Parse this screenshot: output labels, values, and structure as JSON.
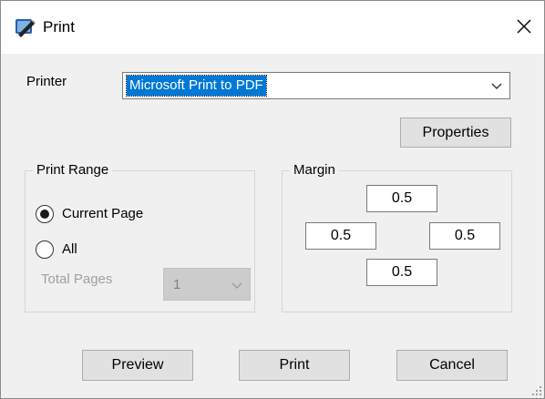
{
  "window": {
    "title": "Print",
    "close_glyph": "✕"
  },
  "printer": {
    "label": "Printer",
    "selected": "Microsoft Print to PDF",
    "properties_label": "Properties"
  },
  "print_range": {
    "legend": "Print Range",
    "options": [
      {
        "label": "Current Page",
        "selected": true
      },
      {
        "label": "All",
        "selected": false
      }
    ],
    "total_pages_label": "Total Pages",
    "total_pages_value": "1"
  },
  "margin": {
    "legend": "Margin",
    "top": "0.5",
    "left": "0.5",
    "right": "0.5",
    "bottom": "0.5"
  },
  "buttons": {
    "preview": "Preview",
    "print": "Print",
    "cancel": "Cancel"
  },
  "icons": {
    "title": "printer-pen-icon",
    "close": "close-icon",
    "dropdown": "chevron-down-icon"
  },
  "colors": {
    "selection": "#0078d7",
    "dialog_bg": "#f0f0f0",
    "button_bg": "#e1e1e1"
  }
}
